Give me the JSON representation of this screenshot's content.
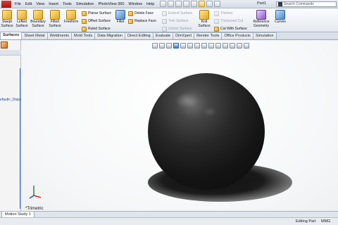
{
  "menu": {
    "items": [
      "File",
      "Edit",
      "View",
      "Insert",
      "Tools",
      "Simulation",
      "PhotoView 360",
      "Window",
      "Help"
    ]
  },
  "document_title": "Part1",
  "search": {
    "placeholder": "Search Commands"
  },
  "ribbon": {
    "big_buttons": [
      {
        "label": "Swept\nSurface"
      },
      {
        "label": "Lofted\nSurface"
      },
      {
        "label": "Boundary\nSurface"
      },
      {
        "label": "Filled\nSurface"
      },
      {
        "label": "Freeform"
      }
    ],
    "col1": [
      "Planar Surface",
      "Offset Surface",
      "Ruled Surface"
    ],
    "fillet": "Fillet",
    "col2": [
      "Delete Face",
      "Replace Face"
    ],
    "col3": [
      "Extend Surface",
      "Trim Surface",
      "Untrim Surface"
    ],
    "knit": "Knit\nSurface",
    "col4": [
      "Thicken",
      "Thickened Cut",
      "Cut With Surface"
    ],
    "reference_geometry": "Reference\nGeometry",
    "curves": "Curves"
  },
  "tabs": [
    "Surfaces",
    "Sheet Metal",
    "Weldments",
    "Mold Tools",
    "Data Migration",
    "Direct Editing",
    "Evaluate",
    "DimXpert",
    "Render Tools",
    "Office Products",
    "Simulation"
  ],
  "active_tab": "Surfaces",
  "tree": {
    "config_label": "efault<_Displa"
  },
  "viewport": {
    "view_orientation": "*Trimetric"
  },
  "motion_tab": "Motion Study 1",
  "status": {
    "mode": "Editing Part",
    "units": "MMG"
  },
  "colors": {
    "accent": "#2f6ad8",
    "body": "#141414"
  }
}
